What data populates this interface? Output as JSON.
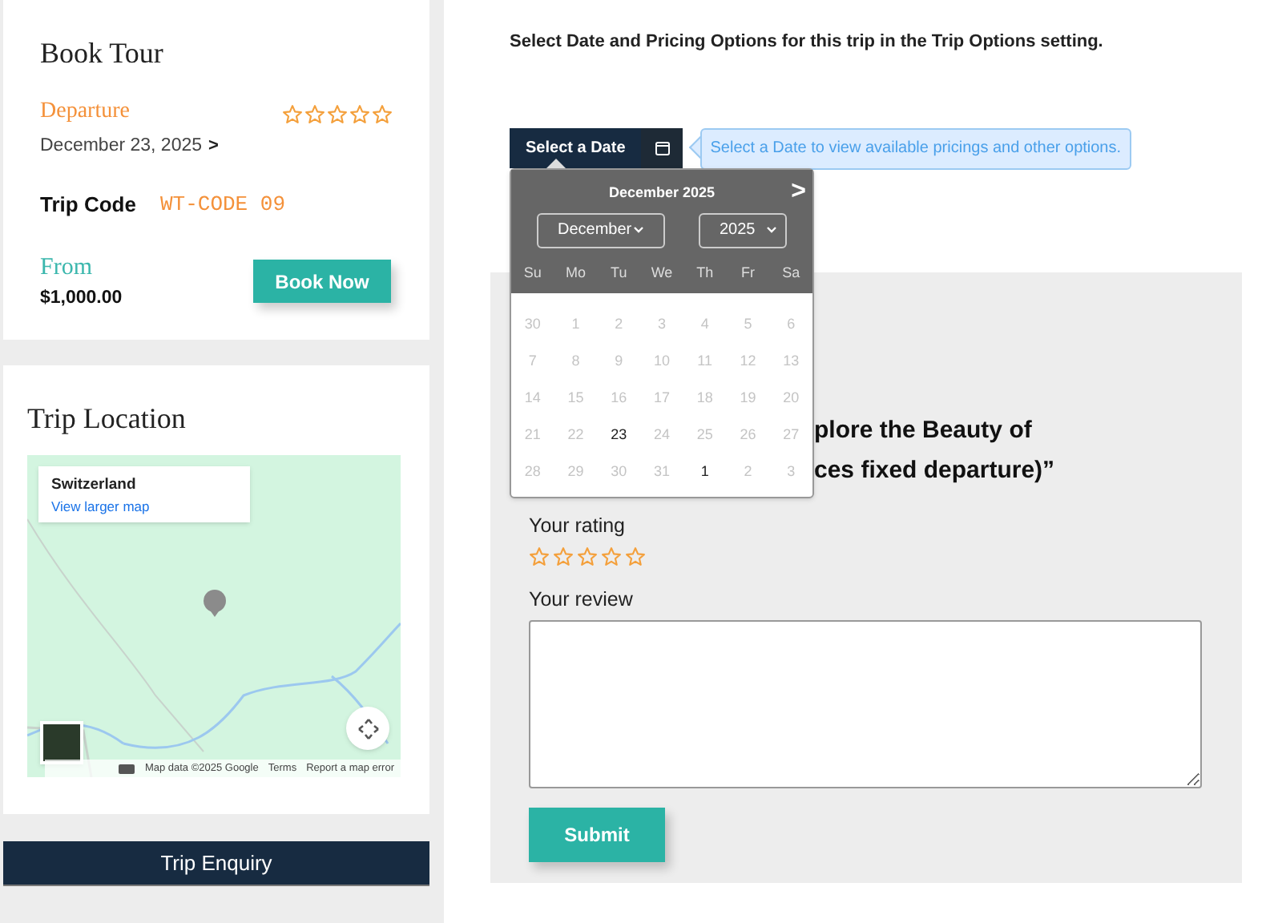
{
  "booking": {
    "title": "Book Tour",
    "departure_label": "Departure",
    "departure_date": "December 23, 2025",
    "departure_arrow": ">",
    "stars": 0,
    "trip_code_label": "Trip Code",
    "trip_code": "WT-CODE 09",
    "from_label": "From",
    "price": "$1,000.00",
    "book_button": "Book Now"
  },
  "location": {
    "title": "Trip Location",
    "place_card": {
      "name": "Switzerland",
      "link": "View larger map"
    },
    "attribution": [
      "Map data ©2025 Google",
      "Terms",
      "Report a map error"
    ]
  },
  "enquiry_button": "Trip Enquiry",
  "notice": "Select Date and Pricing Options for this trip in the Trip Options setting.",
  "date_button": "Select a Date",
  "date_hint": "Select a Date to view available pricings and other options.",
  "calendar": {
    "title": "December 2025",
    "next": ">",
    "month": "December",
    "year": "2025",
    "weekdays": [
      "Su",
      "Mo",
      "Tu",
      "We",
      "Th",
      "Fr",
      "Sa"
    ],
    "weeks": [
      [
        {
          "text": "30",
          "available": false
        },
        {
          "text": "1",
          "available": false
        },
        {
          "text": "2",
          "available": false
        },
        {
          "text": "3",
          "available": false
        },
        {
          "text": "4",
          "available": false
        },
        {
          "text": "5",
          "available": false
        },
        {
          "text": "6",
          "available": false
        }
      ],
      [
        {
          "text": "7",
          "available": false
        },
        {
          "text": "8",
          "available": false
        },
        {
          "text": "9",
          "available": false
        },
        {
          "text": "10",
          "available": false
        },
        {
          "text": "11",
          "available": false
        },
        {
          "text": "12",
          "available": false
        },
        {
          "text": "13",
          "available": false
        }
      ],
      [
        {
          "text": "14",
          "available": false
        },
        {
          "text": "15",
          "available": false
        },
        {
          "text": "16",
          "available": false
        },
        {
          "text": "17",
          "available": false
        },
        {
          "text": "18",
          "available": false
        },
        {
          "text": "19",
          "available": false
        },
        {
          "text": "20",
          "available": false
        }
      ],
      [
        {
          "text": "21",
          "available": false
        },
        {
          "text": "22",
          "available": false
        },
        {
          "text": "23",
          "available": true
        },
        {
          "text": "24",
          "available": false
        },
        {
          "text": "25",
          "available": false
        },
        {
          "text": "26",
          "available": false
        },
        {
          "text": "27",
          "available": false
        }
      ],
      [
        {
          "text": "28",
          "available": false
        },
        {
          "text": "29",
          "available": false
        },
        {
          "text": "30",
          "available": false
        },
        {
          "text": "31",
          "available": false
        },
        {
          "text": "1",
          "available": true
        },
        {
          "text": "2",
          "available": false
        },
        {
          "text": "3",
          "available": false
        }
      ]
    ]
  },
  "review": {
    "heading_lines": [
      "plore the Beauty of",
      "ces fixed departure)”"
    ],
    "rating_label": "Your rating",
    "stars": 0,
    "review_label": "Your review",
    "submit": "Submit"
  }
}
